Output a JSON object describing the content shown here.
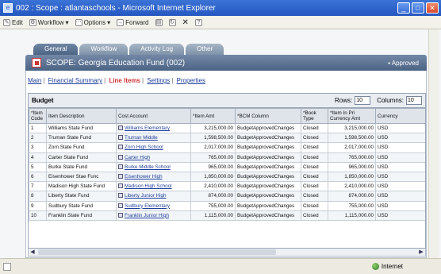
{
  "window": {
    "title": "002 : Scope : atlantaschools - Microsoft Internet Explorer",
    "controls": [
      "minimize",
      "maximize",
      "close"
    ]
  },
  "toolbar": {
    "items": [
      {
        "label": "Edit",
        "icon": "pencil-icon"
      },
      {
        "label": "Workflow",
        "icon": "workflow-icon",
        "dropdown": true
      },
      {
        "label": "Options",
        "icon": "options-icon",
        "dropdown": true
      },
      {
        "label": "Forward",
        "icon": "forward-icon"
      }
    ]
  },
  "tabs": [
    "General",
    "Workflow",
    "Activity Log",
    "Other"
  ],
  "header": {
    "scope_title": "SCOPE: Georgia Education Fund (002)",
    "status": "▪ Approved"
  },
  "subnav": {
    "main": "Main",
    "financial_summary": "Financial Summary",
    "line_items": "Line Items",
    "settings": "Settings",
    "properties": "Properties"
  },
  "grid": {
    "title": "Budget",
    "rows_label": "Rows:",
    "rows_value": "10",
    "columns_label": "Columns:",
    "columns_value": "10",
    "headers": [
      "*Item Code",
      "Item Description",
      "Cost Account",
      "*Item Amt",
      "*BCM Column",
      "*Book Type",
      "*Item In Pri Currency Amt",
      "Currency"
    ],
    "rows": [
      [
        "1",
        "Williams State Fund",
        "Williams Elementary",
        "3,215,000.00",
        "BudgetApprovedChanges",
        "Closed",
        "3,215,000.00",
        "USD"
      ],
      [
        "2",
        "Truman State Fund",
        "Truman Middle",
        "1,598,500.00",
        "BudgetApprovedChanges",
        "Closed",
        "1,598,500.00",
        "USD"
      ],
      [
        "3",
        "Zorn State Fund",
        "Zorn High School",
        "2,017,000.00",
        "BudgetApprovedChanges",
        "Closed",
        "2,017,000.00",
        "USD"
      ],
      [
        "4",
        "Carter State Fund",
        "Carter High",
        "765,000.00",
        "BudgetApprovedChanges",
        "Closed",
        "765,000.00",
        "USD"
      ],
      [
        "5",
        "Burke State Fund",
        "Burke Middle School",
        "965,000.00",
        "BudgetApprovedChanges",
        "Closed",
        "965,000.00",
        "USD"
      ],
      [
        "6",
        "Eisenhower Stae Func",
        "Eisenhower High",
        "1,850,000.00",
        "BudgetApprovedChanges",
        "Closed",
        "1,850,000.00",
        "USD"
      ],
      [
        "7",
        "Madison High State Fund",
        "Madison High School",
        "2,410,000.00",
        "BudgetApprovedChanges",
        "Closed",
        "2,410,000.00",
        "USD"
      ],
      [
        "8",
        "Liberty State Fund",
        "Liberty Junior High",
        "874,000.00",
        "BudgetApprovedChanges",
        "Closed",
        "874,000.00",
        "USD"
      ],
      [
        "9",
        "Sudbury State Fund",
        "Sudbury Elementary",
        "755,000.00",
        "BudgetApprovedChanges",
        "Closed",
        "755,000.00",
        "USD"
      ],
      [
        "10",
        "Franklin State Fund",
        "Franklin Junior High",
        "1,115,000.00",
        "BudgetApprovedChanges",
        "Closed",
        "1,115,000.00",
        "USD"
      ]
    ]
  },
  "statusbar": {
    "zone": "Internet"
  },
  "colors": {
    "title_bar": "#2557c0",
    "header_bar": "#4b6384",
    "link": "#1f3f9c",
    "current_tab_text": "#cc3333"
  }
}
